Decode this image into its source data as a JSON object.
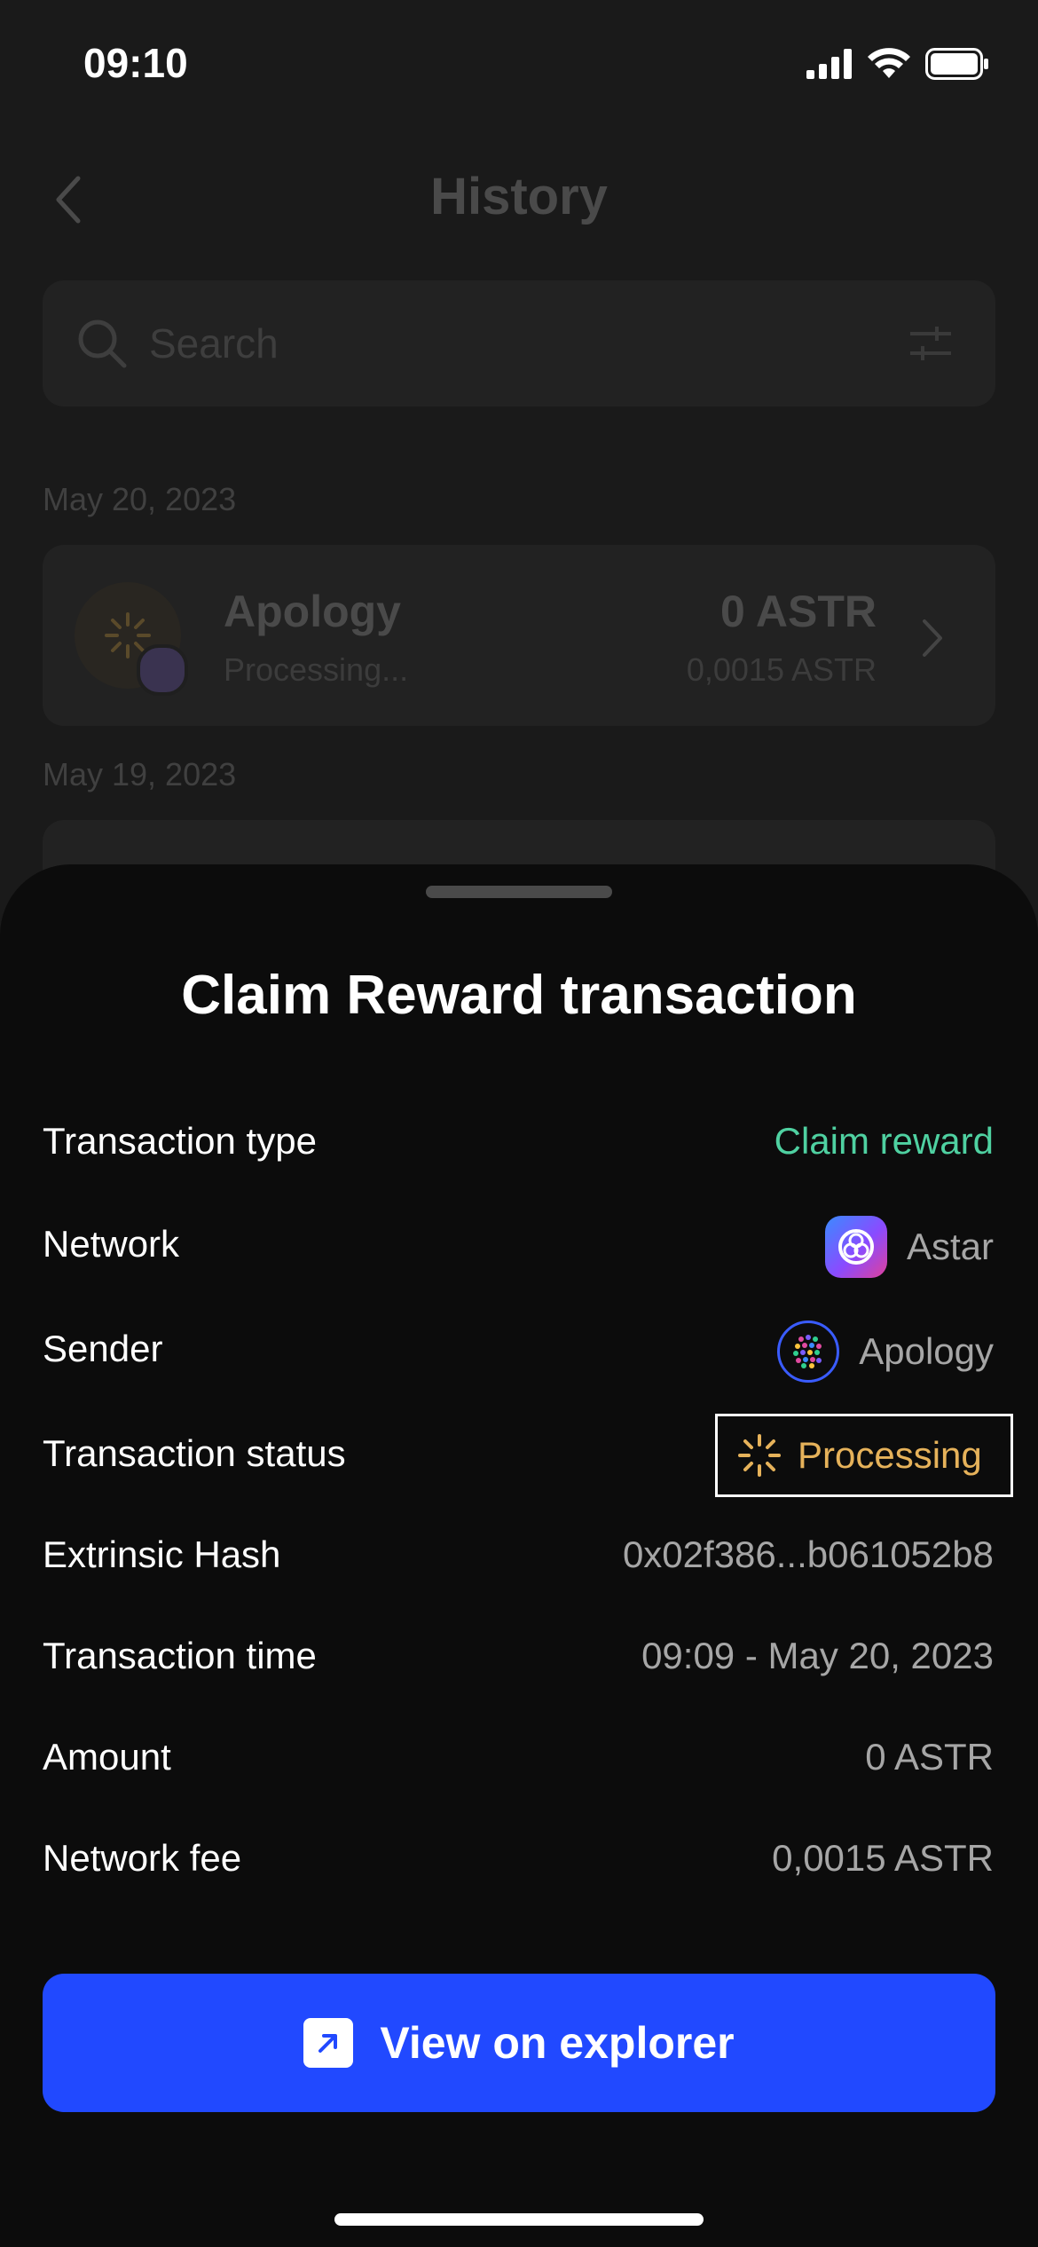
{
  "status_bar": {
    "time": "09:10"
  },
  "background": {
    "title": "History",
    "search": {
      "placeholder": "Search"
    },
    "groups": [
      {
        "date": "May 20, 2023",
        "item": {
          "name": "Apology",
          "status": "Processing...",
          "amount": "0 ASTR",
          "fee": "0,0015 ASTR"
        }
      },
      {
        "date": "May 19, 2023"
      }
    ]
  },
  "sheet": {
    "title": "Claim Reward transaction",
    "rows": [
      {
        "label": "Transaction type",
        "value": "Claim reward"
      },
      {
        "label": "Network",
        "value": "Astar"
      },
      {
        "label": "Sender",
        "value": "Apology"
      },
      {
        "label": "Transaction status",
        "value": "Processing"
      },
      {
        "label": "Extrinsic Hash",
        "value": "0x02f386...b061052b8"
      },
      {
        "label": "Transaction time",
        "value": "09:09 - May 20, 2023"
      },
      {
        "label": "Amount",
        "value": "0 ASTR"
      },
      {
        "label": "Network fee",
        "value": "0,0015 ASTR"
      }
    ],
    "button": {
      "label": "View on explorer",
      "icon": "external-link-icon"
    }
  },
  "colors": {
    "accent_blue": "#2149ff",
    "type_green": "#4fd1a1",
    "processing_orange": "#e6b25a"
  }
}
